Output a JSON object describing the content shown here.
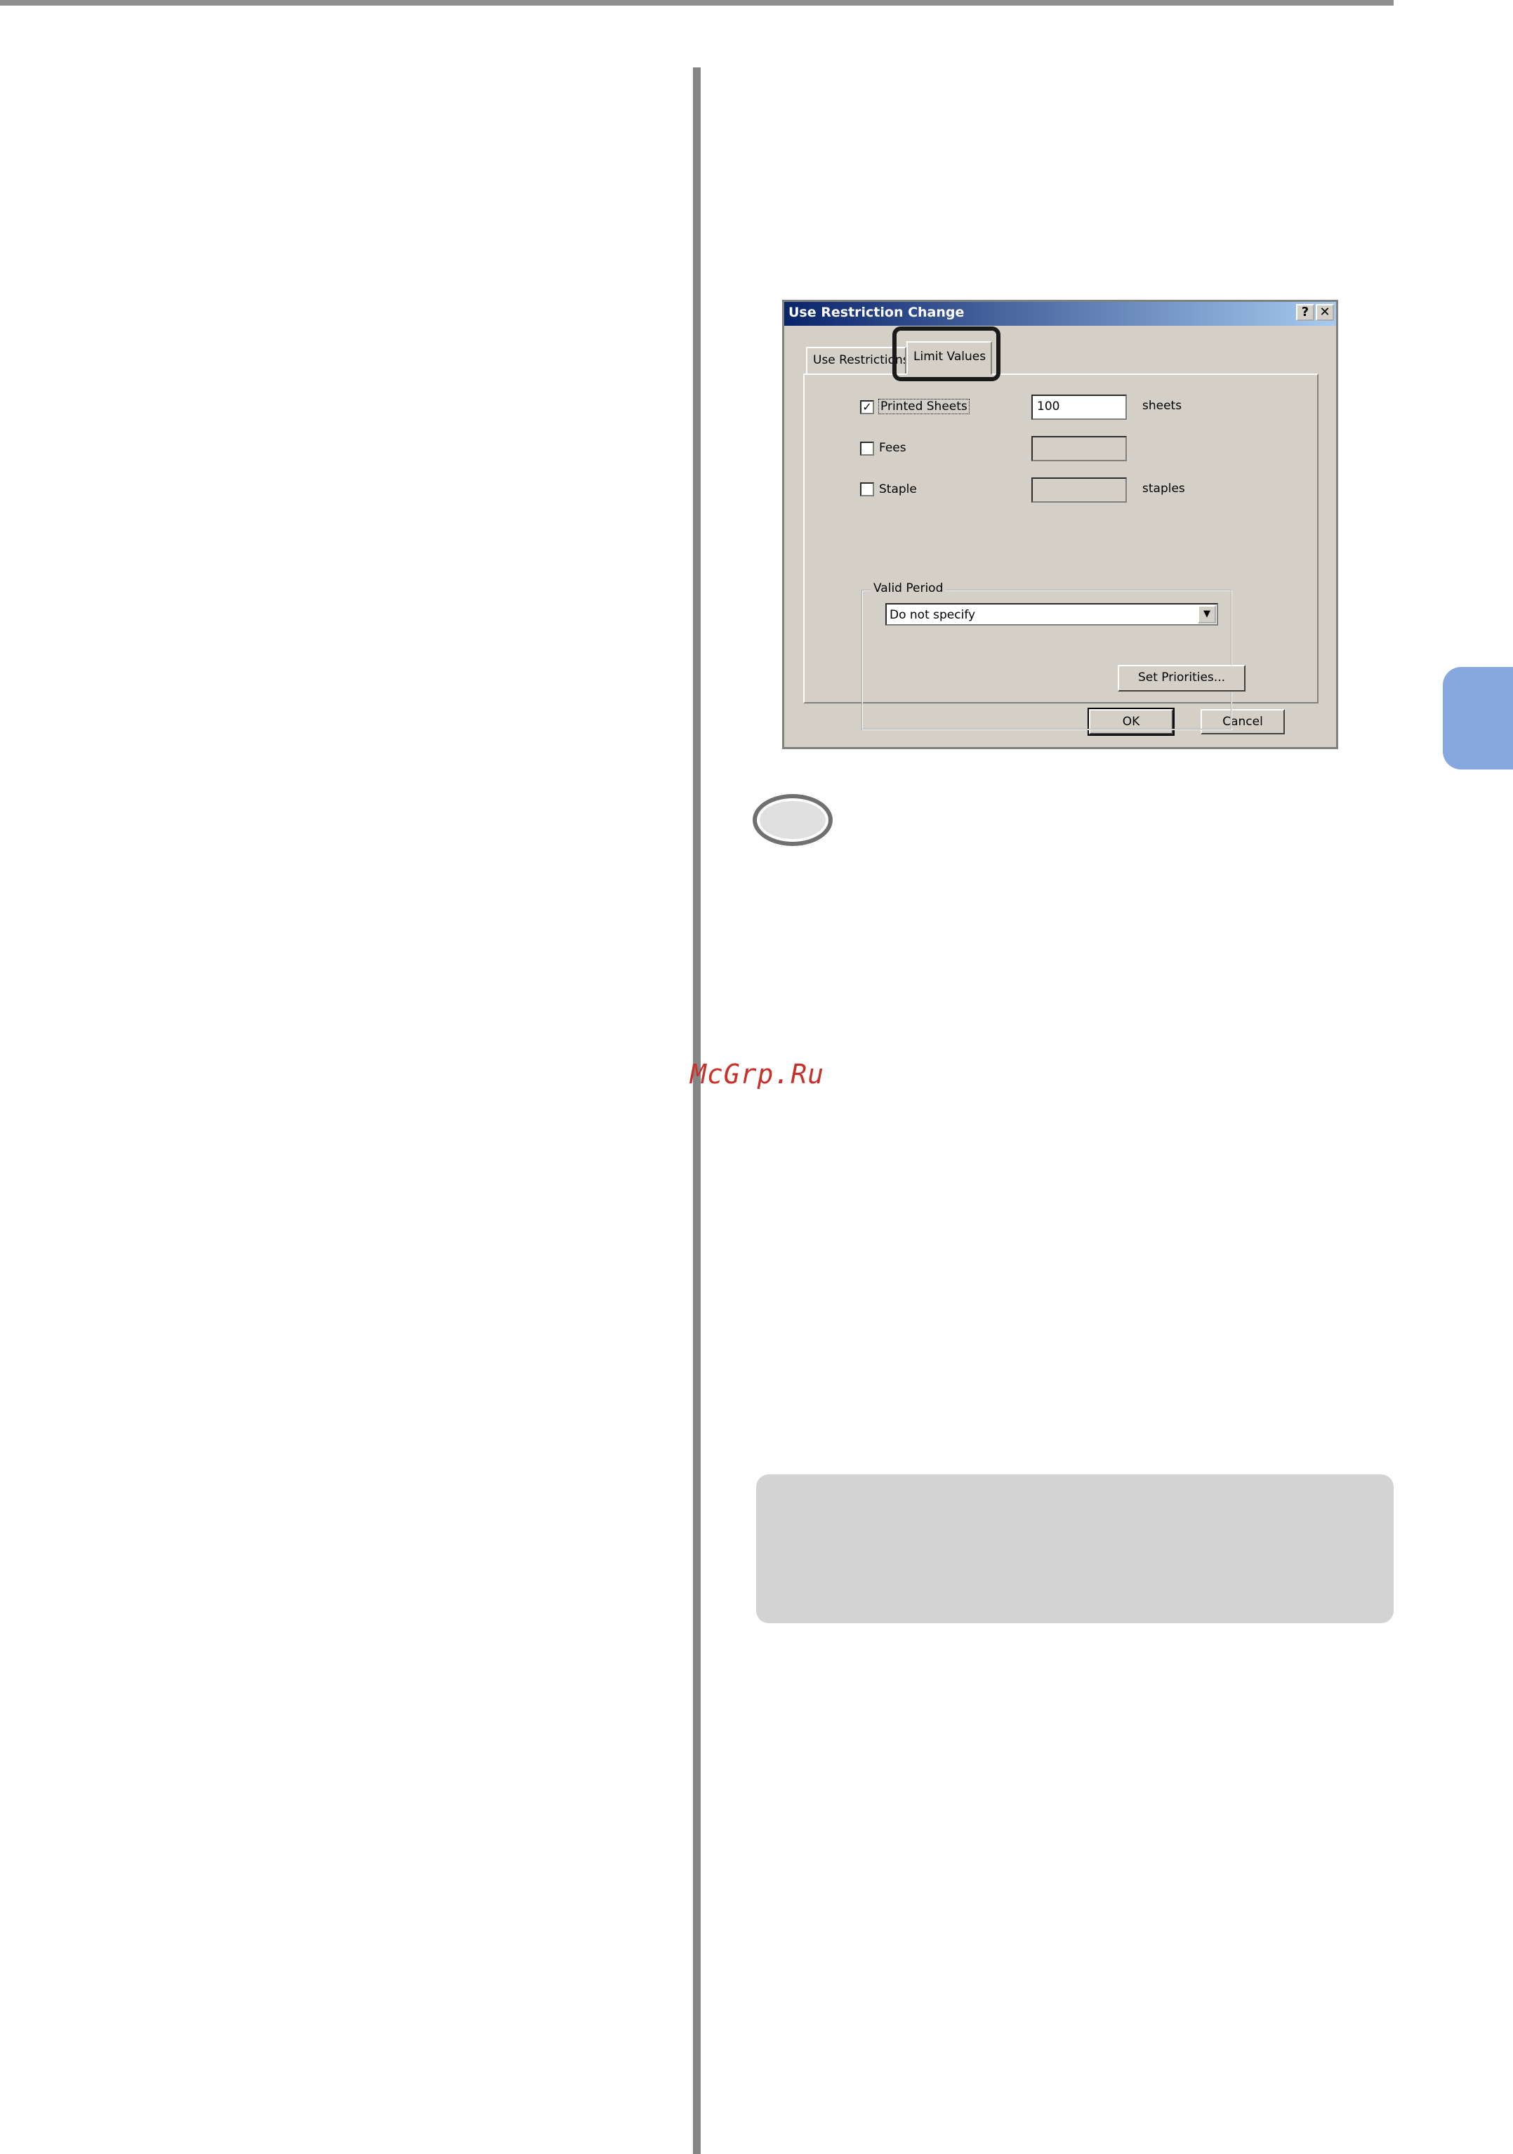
{
  "page": {
    "watermark": "McGrp.Ru"
  },
  "dialog": {
    "title": "Use Restriction Change",
    "help_glyph": "?",
    "close_glyph": "✕",
    "tabs": [
      {
        "label": "Use Restrictions",
        "selected": false
      },
      {
        "label": "Limit Values",
        "selected": true
      }
    ],
    "limits": [
      {
        "label": "Printed Sheets",
        "checked": true,
        "value": "100",
        "unit": "sheets"
      },
      {
        "label": "Fees",
        "checked": false,
        "value": "",
        "unit": ""
      },
      {
        "label": "Staple",
        "checked": false,
        "value": "",
        "unit": "staples"
      }
    ],
    "check_glyph": "✓",
    "valid_period": {
      "legend": "Valid Period",
      "selected": "Do not specify",
      "arrow_glyph": "▼"
    },
    "set_priorities_label": "Set Priorities...",
    "ok_label": "OK",
    "cancel_label": "Cancel"
  },
  "colors": {
    "side_tab": "#87a7df",
    "watermark": "#c8312a",
    "dialog_face": "#d4d0c8",
    "titlebar_start": "#0a246a"
  }
}
